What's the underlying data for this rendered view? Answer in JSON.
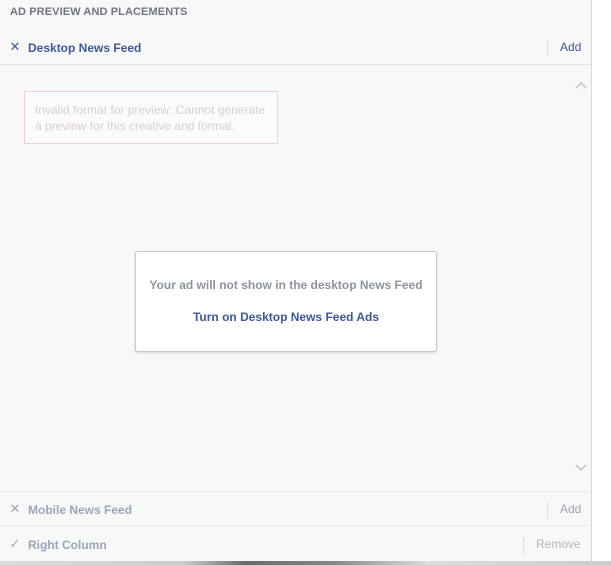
{
  "panel": {
    "title": "AD PREVIEW AND PLACEMENTS"
  },
  "placements": {
    "desktop": {
      "label": "Desktop News Feed",
      "icon": "close-icon",
      "action": "Add"
    },
    "mobile": {
      "label": "Mobile News Feed",
      "icon": "close-icon",
      "action": "Add"
    },
    "right_column": {
      "label": "Right Column",
      "icon": "check-icon",
      "action": "Remove"
    }
  },
  "preview": {
    "error_message": "Invalid format for preview: Cannot generate a preview for this creative and format.",
    "notice_text": "Your ad will not show in the desktop News Feed",
    "notice_link": "Turn on Desktop News Feed Ads"
  },
  "colors": {
    "link": "#3b5998",
    "muted": "#9aa5bb",
    "error_border": "#f5cfc7"
  }
}
